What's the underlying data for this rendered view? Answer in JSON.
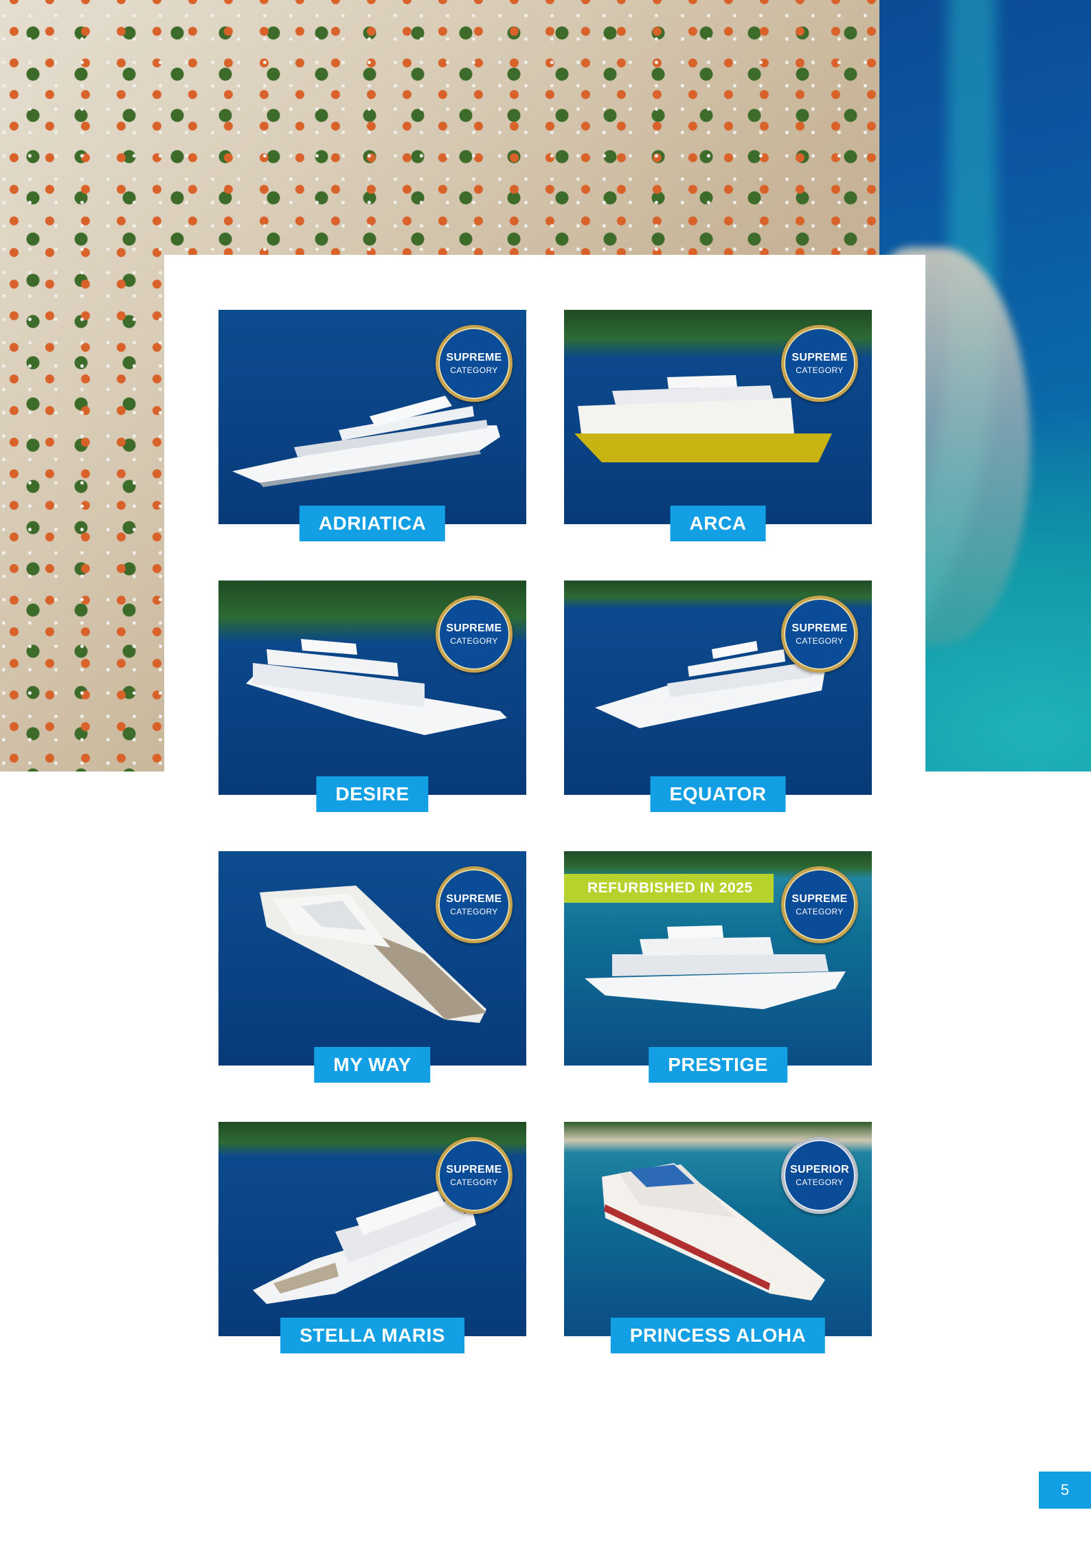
{
  "ships": [
    {
      "name": "ADRIATICA",
      "category_title": "SUPREME",
      "category_sub": "CATEGORY"
    },
    {
      "name": "ARCA",
      "category_title": "SUPREME",
      "category_sub": "CATEGORY"
    },
    {
      "name": "DESIRE",
      "category_title": "SUPREME",
      "category_sub": "CATEGORY"
    },
    {
      "name": "EQUATOR",
      "category_title": "SUPREME",
      "category_sub": "CATEGORY"
    },
    {
      "name": "MY WAY",
      "category_title": "SUPREME",
      "category_sub": "CATEGORY"
    },
    {
      "name": "PRESTIGE",
      "category_title": "SUPREME",
      "category_sub": "CATEGORY",
      "ribbon": "REFURBISHED IN 2025"
    },
    {
      "name": "STELLA MARIS",
      "category_title": "SUPREME",
      "category_sub": "CATEGORY"
    },
    {
      "name": "PRINCESS ALOHA",
      "category_title": "SUPERIOR",
      "category_sub": "CATEGORY"
    }
  ],
  "page_number": "5",
  "colors": {
    "accent_blue": "#139fe3",
    "badge_blue": "#0b4c99",
    "ribbon_green": "#b7d22c"
  }
}
